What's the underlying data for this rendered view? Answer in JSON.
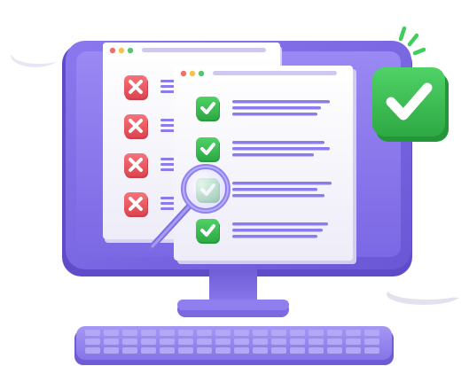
{
  "scene": {
    "subject": "computer-monitor-checklist-illustration"
  },
  "colors": {
    "monitor_body": "#7d6ae6",
    "monitor_screen": "#8f7cf0",
    "monitor_bezel_dark": "#5e4cc8",
    "stand": "#7766de",
    "keyboard": "#9b8cf0",
    "keyboard_key": "#b3a8f6",
    "window_bg": "#f6f5fc",
    "window_titlebar": "#ffffff",
    "line": "#8a7cec",
    "check_green": "#3bbf52",
    "check_green_dark": "#2a9a3f",
    "cross_red": "#ee5a63",
    "cross_red_dark": "#c9414a",
    "dot_red": "#f16f6f",
    "dot_yellow": "#f6c24a",
    "dot_green": "#58c76b",
    "cloud": "#ffffff",
    "cloud_shade": "#e6e6f2",
    "magnifier_ring": "#8f82ee",
    "magnifier_glass": "#e8e5ff",
    "badge_green": "#34c24d",
    "spark_green": "#3ecf5a"
  },
  "back_window": {
    "items": [
      {
        "icon": "cross-icon"
      },
      {
        "icon": "cross-icon"
      },
      {
        "icon": "cross-icon"
      },
      {
        "icon": "cross-icon"
      }
    ]
  },
  "front_window": {
    "items": [
      {
        "icon": "check-icon"
      },
      {
        "icon": "check-icon"
      },
      {
        "icon": "check-icon"
      },
      {
        "icon": "check-icon"
      }
    ]
  },
  "badge": {
    "icon": "big-check-icon"
  }
}
